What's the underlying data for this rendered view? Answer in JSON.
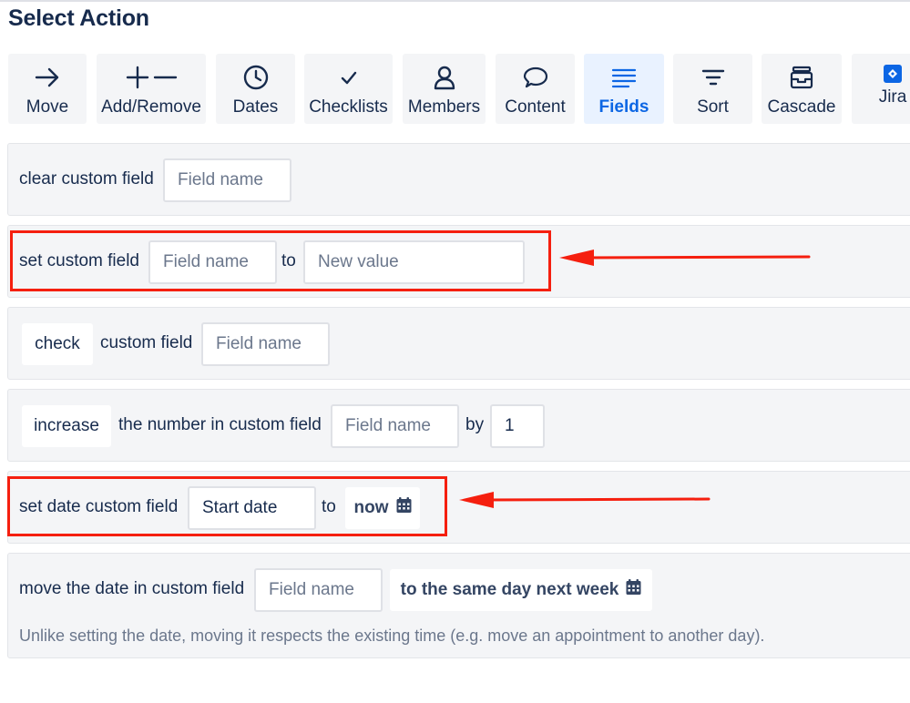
{
  "title": "Select Action",
  "tabs": [
    {
      "label": "Move",
      "icon": "arrow-right-icon",
      "active": false
    },
    {
      "label": "Add/Remove",
      "icon": "plus-minus-icon",
      "active": false
    },
    {
      "label": "Dates",
      "icon": "clock-icon",
      "active": false
    },
    {
      "label": "Checklists",
      "icon": "check-icon",
      "active": false
    },
    {
      "label": "Members",
      "icon": "person-icon",
      "active": false
    },
    {
      "label": "Content",
      "icon": "speech-bubble-icon",
      "active": false
    },
    {
      "label": "Fields",
      "icon": "lines-icon",
      "active": true
    },
    {
      "label": "Sort",
      "icon": "filter-icon",
      "active": false
    },
    {
      "label": "Cascade",
      "icon": "archive-icon",
      "active": false
    },
    {
      "label": "Jira",
      "icon": "jira-icon",
      "active": false
    }
  ],
  "actions": {
    "clear": {
      "text": "clear custom field",
      "field_placeholder": "Field name"
    },
    "set": {
      "text": "set custom field",
      "field_placeholder": "Field name",
      "to": "to",
      "value_placeholder": "New value"
    },
    "check": {
      "button": "check",
      "text": "custom field",
      "field_placeholder": "Field name"
    },
    "increase": {
      "button": "increase",
      "text": "the number in custom field",
      "field_placeholder": "Field name",
      "by": "by",
      "amount": "1"
    },
    "set_date": {
      "text": "set date custom field",
      "field_value": "Start date",
      "to": "to",
      "date_option": "now"
    },
    "move_date": {
      "text": "move the date in custom field",
      "field_placeholder": "Field name",
      "date_option": "to the same day next week",
      "note": "Unlike setting the date, moving it respects the existing time (e.g. move an appointment to another day)."
    }
  },
  "colors": {
    "highlight": "#f51f0f",
    "active_tab_bg": "#e9f2ff",
    "active_tab_text": "#0c66e4",
    "row_bg": "#f4f5f7"
  }
}
